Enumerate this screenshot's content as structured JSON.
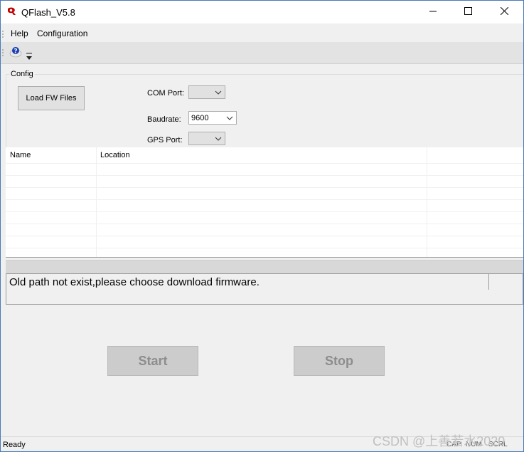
{
  "window": {
    "title": "QFlash_V5.8",
    "icons": {
      "app": "qflash-logo-icon",
      "minimize": "minimize-icon",
      "maximize": "maximize-icon",
      "close": "close-icon"
    }
  },
  "menu": {
    "items": [
      {
        "label": "Help"
      },
      {
        "label": "Configuration"
      }
    ]
  },
  "toolbar": {
    "icons": [
      "help-about-icon",
      "toolbar-dropdown-arrow-icon"
    ]
  },
  "config": {
    "group_label": "Config",
    "load_button": "Load FW Files",
    "com_port": {
      "label": "COM Port:",
      "value": ""
    },
    "baudrate": {
      "label": "Baudrate:",
      "value": "9600"
    },
    "gps_port": {
      "label": "GPS Port:",
      "value": ""
    }
  },
  "files_table": {
    "columns": [
      "Name",
      "Location"
    ],
    "rows": []
  },
  "message": "Old path not exist,please choose download firmware.",
  "buttons": {
    "start": "Start",
    "stop": "Stop"
  },
  "statusbar": {
    "status": "Ready",
    "indicators": [
      "CAP",
      "NUM",
      "SCRL"
    ]
  },
  "watermark": "CSDN @上善若水2020"
}
